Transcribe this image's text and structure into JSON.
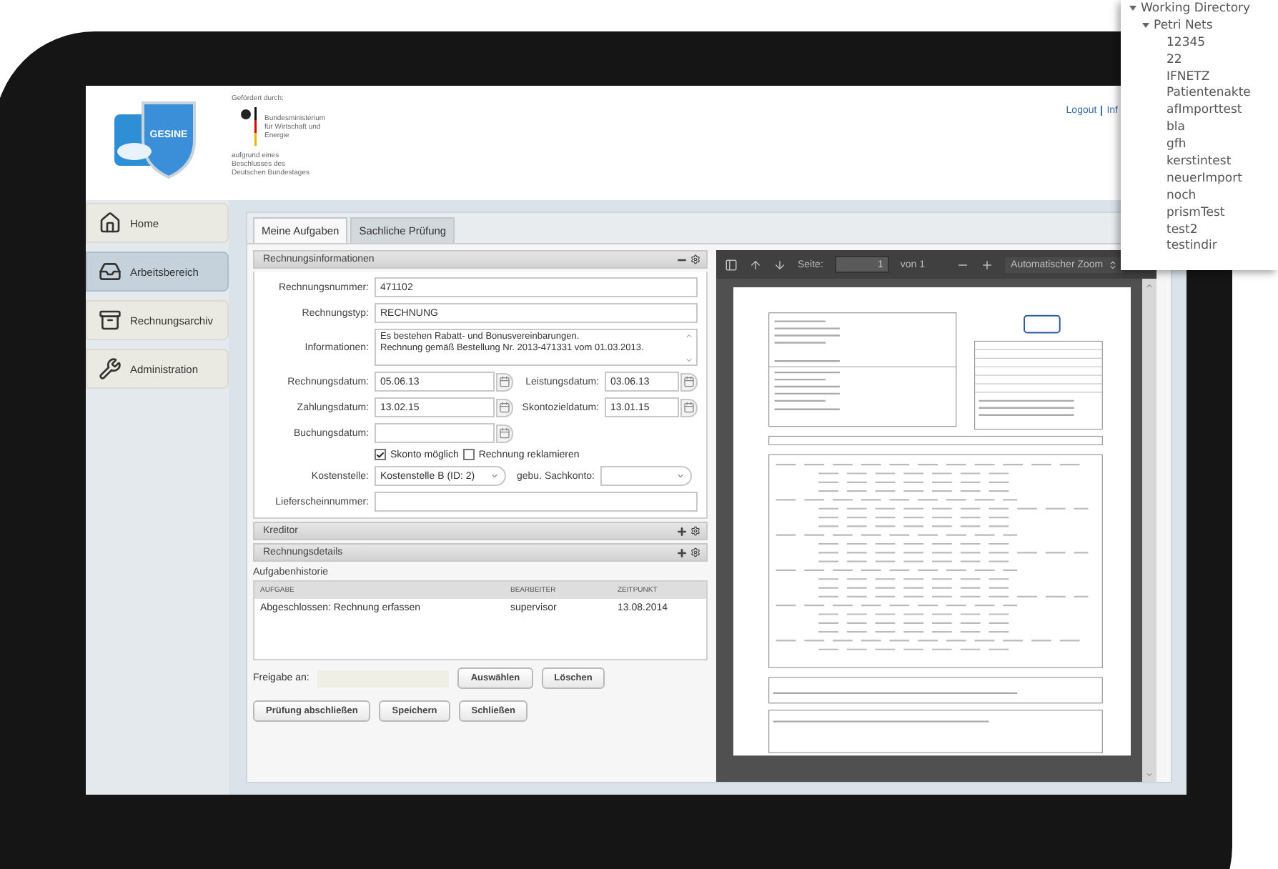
{
  "header": {
    "logo_text": "GESINE",
    "sponsor_caption": "Gefördert durch:",
    "ministry": "Bundesministerium für Wirtschaft und Energie",
    "resolution": "aufgrund eines Beschlusses des Deutschen Bundestages",
    "links": [
      "Logout",
      "Inf"
    ]
  },
  "nav": [
    {
      "label": "Home",
      "kind": "home",
      "selected": false
    },
    {
      "label": "Arbeitsbereich",
      "kind": "inbox",
      "selected": true
    },
    {
      "label": "Rechnungsarchiv",
      "kind": "archive",
      "selected": false
    },
    {
      "label": "Administration",
      "kind": "tools",
      "selected": false
    }
  ],
  "tabs": [
    {
      "label": "Meine Aufgaben",
      "selected": false
    },
    {
      "label": "Sachliche Prüfung",
      "selected": true
    }
  ],
  "invoice_panel": {
    "title": "Rechnungsinformationen",
    "expanded": true,
    "number": {
      "label": "Rechnungsnummer:",
      "value": "471102"
    },
    "type": {
      "label": "Rechnungstyp:",
      "value": "RECHNUNG"
    },
    "info": {
      "label": "Informationen:",
      "lines": [
        "Es bestehen Rabatt- und Bonusvereinbarungen.",
        "Rechnung gemäß Bestellung Nr. 2013-471331 vom 01.03.2013."
      ]
    },
    "dates": [
      {
        "label": "Rechnungsdatum:",
        "value": "05.06.13"
      },
      {
        "label": "Leistungsdatum:",
        "value": "03.06.13"
      },
      {
        "label": "Zahlungsdatum:",
        "value": "13.02.15"
      },
      {
        "label": "Skontozieldatum:",
        "value": "13.01.15"
      },
      {
        "label": "Buchungsdatum:"
      }
    ],
    "checkboxes": [
      {
        "label": "Skonto möglich",
        "checked": true
      },
      {
        "label": "Rechnung reklamieren",
        "checked": false
      }
    ],
    "cost_center": {
      "label": "Kostenstelle:",
      "value": "Kostenstelle B (ID: 2)"
    },
    "account": {
      "label": "gebu. Sachkonto:"
    },
    "delivery": {
      "label": "Lieferscheinnummer:"
    }
  },
  "sections": [
    {
      "title": "Kreditor",
      "expanded": false
    },
    {
      "title": "Rechnungsdetails",
      "expanded": false
    }
  ],
  "history": {
    "title": "Aufgabenhistorie",
    "columns": [
      "AUFGABE",
      "BEARBEITER",
      "ZEITPUNKT"
    ],
    "rows": [
      [
        "Abgeschlossen: Rechnung erfassen",
        "supervisor",
        "13.08.2014"
      ]
    ]
  },
  "release": {
    "label": "Freigabe an:",
    "buttons": [
      "Auswählen",
      "Löschen"
    ]
  },
  "actions": [
    "Prüfung abschließen",
    "Speichern",
    "Schließen"
  ],
  "pdf_viewer": {
    "page_label": "Seite:",
    "page": "1",
    "page_count": "von 1",
    "zoom": "Automatischer Zoom"
  },
  "popup_tree": [
    {
      "label": "Working Directory",
      "expanded": true,
      "children": [
        {
          "label": "Petri Nets",
          "expanded": true,
          "children": [
            {
              "label": "12345"
            },
            {
              "label": "22"
            },
            {
              "label": "IFNETZ"
            },
            {
              "label": "Patientenakte"
            },
            {
              "label": "afImporttest"
            },
            {
              "label": "bla"
            },
            {
              "label": "gfh"
            },
            {
              "label": "kerstintest"
            },
            {
              "label": "neuerImport"
            },
            {
              "label": "noch"
            },
            {
              "label": "prismTest"
            },
            {
              "label": "test2"
            },
            {
              "label": "testindir"
            }
          ]
        }
      ]
    }
  ]
}
